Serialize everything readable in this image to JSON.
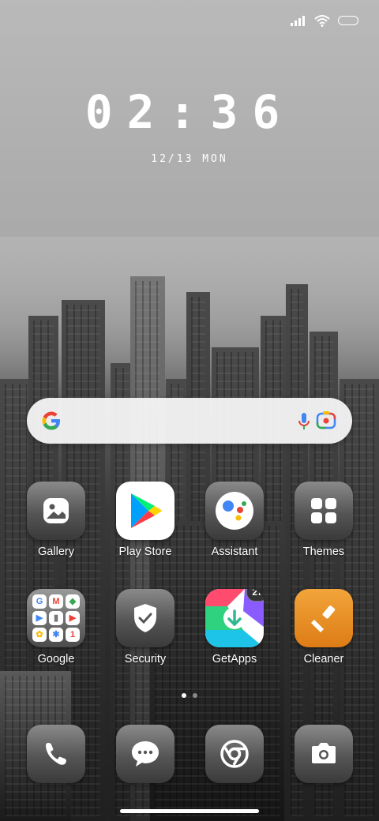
{
  "status_bar": {
    "signal_icon": "signal-icon",
    "wifi_icon": "wifi-icon",
    "battery_icon": "battery-icon"
  },
  "lock_clock": {
    "time": "02:36",
    "date": "12/13 MON"
  },
  "search_bar": {
    "logo_icon": "google-g-icon",
    "mic_icon": "mic-icon",
    "lens_icon": "lens-icon"
  },
  "apps": [
    {
      "label": "Gallery",
      "icon": "gallery-icon"
    },
    {
      "label": "Play Store",
      "icon": "play-store-icon"
    },
    {
      "label": "Assistant",
      "icon": "assistant-icon"
    },
    {
      "label": "Themes",
      "icon": "themes-icon"
    },
    {
      "label": "Google",
      "icon": "google-folder-icon"
    },
    {
      "label": "Security",
      "icon": "security-icon"
    },
    {
      "label": "GetApps",
      "icon": "getapps-icon",
      "badge": "27"
    },
    {
      "label": "Cleaner",
      "icon": "cleaner-icon"
    }
  ],
  "dock": [
    {
      "icon": "phone-icon"
    },
    {
      "icon": "messages-icon"
    },
    {
      "icon": "chrome-icon"
    },
    {
      "icon": "camera-icon"
    }
  ],
  "page_indicator": {
    "pages": 2,
    "active": 1
  },
  "colors": {
    "accent_orange": "#e8901f",
    "badge_bg": "#333333"
  }
}
